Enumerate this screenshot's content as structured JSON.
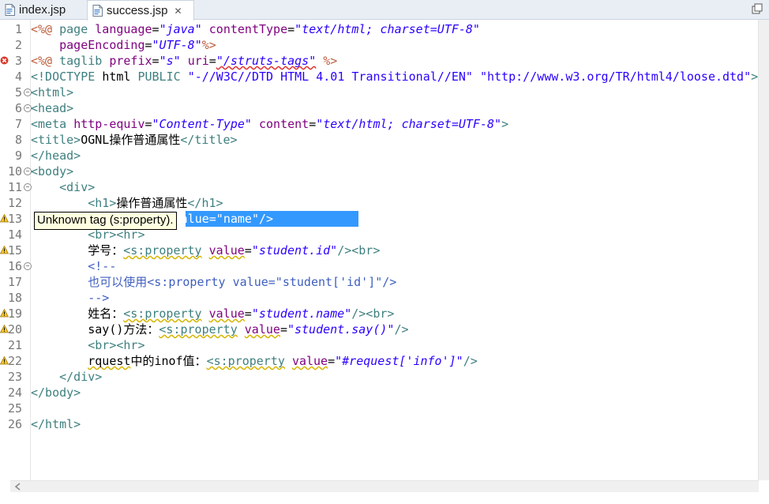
{
  "tabs": [
    {
      "label": "index.jsp",
      "active": false
    },
    {
      "label": "success.jsp",
      "active": true,
      "close": "✕"
    }
  ],
  "tooltip": "Unknown tag (s:property).",
  "lines": [
    {
      "n": "1",
      "segs": [
        [
          "jsp",
          "<%@ "
        ],
        [
          "kw",
          "page "
        ],
        [
          "attr",
          "language"
        ],
        [
          "txt",
          "="
        ],
        [
          "str",
          "\"java\""
        ],
        [
          "txt",
          " "
        ],
        [
          "attr",
          "contentType"
        ],
        [
          "txt",
          "="
        ],
        [
          "str",
          "\"text/html; charset=UTF-8\""
        ]
      ]
    },
    {
      "n": "2",
      "segs": [
        [
          "txt",
          "    "
        ],
        [
          "attr",
          "pageEncoding"
        ],
        [
          "txt",
          "="
        ],
        [
          "str",
          "\"UTF-8\""
        ],
        [
          "jsp",
          "%>"
        ]
      ]
    },
    {
      "n": "3",
      "mark": "error",
      "segs": [
        [
          "jsp",
          "<%@ "
        ],
        [
          "kw",
          "taglib "
        ],
        [
          "attr",
          "prefix"
        ],
        [
          "txt",
          "="
        ],
        [
          "str",
          "\"s\""
        ],
        [
          "txt",
          " "
        ],
        [
          "attr",
          "uri"
        ],
        [
          "txt",
          "="
        ],
        [
          "str sqr",
          "\"/struts-tags\""
        ],
        [
          "txt",
          " "
        ],
        [
          "jsp",
          "%>"
        ]
      ]
    },
    {
      "n": "4",
      "segs": [
        [
          "tagc",
          "<!DOCTYPE "
        ],
        [
          "txt",
          "html "
        ],
        [
          "kw",
          "PUBLIC "
        ],
        [
          "strn",
          "\"-//W3C//DTD HTML 4.01 Transitional//EN\""
        ],
        [
          "txt",
          " "
        ],
        [
          "strn",
          "\"http://www.w3.org/TR/html4/loose.dtd\""
        ],
        [
          "tagc",
          ">"
        ]
      ]
    },
    {
      "n": "5",
      "fold": true,
      "segs": [
        [
          "tagc",
          "<html>"
        ]
      ]
    },
    {
      "n": "6",
      "fold": true,
      "segs": [
        [
          "tagc",
          "<head>"
        ]
      ]
    },
    {
      "n": "7",
      "segs": [
        [
          "tagc",
          "<meta "
        ],
        [
          "attr",
          "http-equiv"
        ],
        [
          "txt",
          "="
        ],
        [
          "str",
          "\"Content-Type\""
        ],
        [
          "txt",
          " "
        ],
        [
          "attr",
          "content"
        ],
        [
          "txt",
          "="
        ],
        [
          "str",
          "\"text/html; charset=UTF-8\""
        ],
        [
          "tagc",
          ">"
        ]
      ]
    },
    {
      "n": "8",
      "segs": [
        [
          "tagc",
          "<title>"
        ],
        [
          "txt",
          "OGNL操作普通属性"
        ],
        [
          "tagc",
          "</title>"
        ]
      ]
    },
    {
      "n": "9",
      "segs": [
        [
          "tagc",
          "</head>"
        ]
      ]
    },
    {
      "n": "10",
      "fold": true,
      "segs": [
        [
          "tagc",
          "<body>"
        ]
      ]
    },
    {
      "n": "11",
      "fold": true,
      "segs": [
        [
          "txt",
          "    "
        ],
        [
          "tagc",
          "<div>"
        ]
      ]
    },
    {
      "n": "12",
      "segs": [
        [
          "txt",
          "        "
        ],
        [
          "tagc",
          "<h1>"
        ],
        [
          "txt",
          "操作普通属性"
        ],
        [
          "tagc",
          "</h1>"
        ]
      ]
    },
    {
      "n": "13",
      "mark": "warn",
      "selected": true,
      "segs": [
        [
          "txt",
          "        "
        ],
        [
          "tagc",
          "<s"
        ],
        [
          "sel-txt",
          ":property value=\"name\"/>"
        ]
      ]
    },
    {
      "n": "14",
      "segs": [
        [
          "txt",
          "        "
        ],
        [
          "tagc",
          "<br><hr>"
        ]
      ]
    },
    {
      "n": "15",
      "mark": "warn",
      "segs": [
        [
          "txt",
          "        学号："
        ],
        [
          "tagc sq",
          "<s:property"
        ],
        [
          "txt",
          " "
        ],
        [
          "attr sq",
          "value"
        ],
        [
          "txt",
          "="
        ],
        [
          "str",
          "\"student.id\""
        ],
        [
          "tagc",
          "/><br>"
        ]
      ]
    },
    {
      "n": "16",
      "fold": true,
      "segs": [
        [
          "txt",
          "        "
        ],
        [
          "cmt",
          "<!--"
        ]
      ]
    },
    {
      "n": "17",
      "segs": [
        [
          "cmt",
          "        也可以使用<s:property value=\"student['id']\"/>"
        ]
      ]
    },
    {
      "n": "18",
      "segs": [
        [
          "cmt",
          "        -->"
        ]
      ]
    },
    {
      "n": "19",
      "mark": "warn",
      "segs": [
        [
          "txt",
          "        姓名："
        ],
        [
          "tagc sq",
          "<s:property"
        ],
        [
          "txt",
          " "
        ],
        [
          "attr sq",
          "value"
        ],
        [
          "txt",
          "="
        ],
        [
          "str",
          "\"student.name\""
        ],
        [
          "tagc",
          "/><br>"
        ]
      ]
    },
    {
      "n": "20",
      "mark": "warn",
      "segs": [
        [
          "txt",
          "        say()方法："
        ],
        [
          "tagc sq",
          "<s:property"
        ],
        [
          "txt",
          " "
        ],
        [
          "attr sq",
          "value"
        ],
        [
          "txt",
          "="
        ],
        [
          "str",
          "\"student.say()\""
        ],
        [
          "tagc",
          "/>"
        ]
      ]
    },
    {
      "n": "21",
      "segs": [
        [
          "txt",
          "        "
        ],
        [
          "tagc",
          "<br><hr>"
        ]
      ]
    },
    {
      "n": "22",
      "mark": "warn",
      "segs": [
        [
          "txt",
          "        "
        ],
        [
          "txt sq",
          "rquest"
        ],
        [
          "txt",
          "中的inof值："
        ],
        [
          "tagc sq",
          "<s:property"
        ],
        [
          "txt",
          " "
        ],
        [
          "attr sq",
          "value"
        ],
        [
          "txt",
          "="
        ],
        [
          "str",
          "\"#request['info']\""
        ],
        [
          "tagc",
          "/>"
        ]
      ]
    },
    {
      "n": "23",
      "segs": [
        [
          "txt",
          "    "
        ],
        [
          "tagc",
          "</div>"
        ]
      ]
    },
    {
      "n": "24",
      "segs": [
        [
          "tagc",
          "</body>"
        ]
      ]
    },
    {
      "n": "25",
      "segs": []
    },
    {
      "n": "26",
      "segs": [
        [
          "tagc",
          "</html>"
        ]
      ]
    }
  ]
}
